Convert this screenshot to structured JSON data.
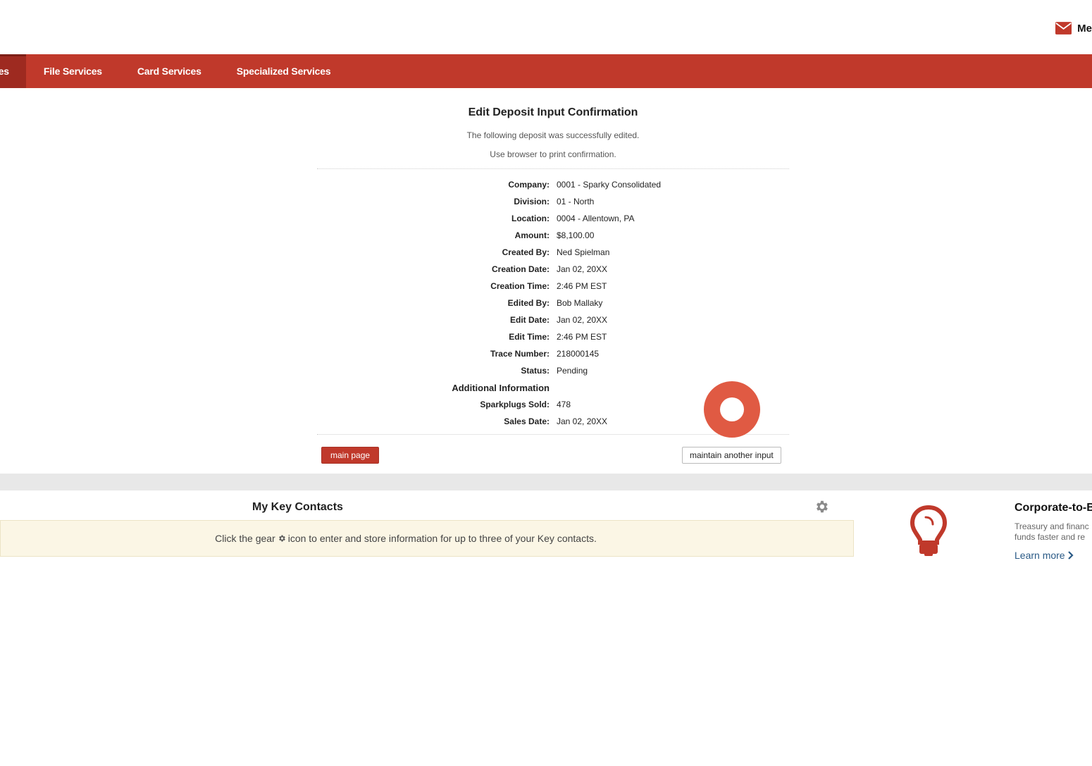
{
  "header": {
    "messages_label": "Me"
  },
  "nav": {
    "items": [
      {
        "label": "les"
      },
      {
        "label": "File Services"
      },
      {
        "label": "Card Services"
      },
      {
        "label": "Specialized Services"
      }
    ]
  },
  "confirmation": {
    "title": "Edit Deposit Input Confirmation",
    "message": "The following deposit was successfully edited.",
    "print_note": "Use browser to print confirmation.",
    "fields": [
      {
        "label": "Company:",
        "value": "0001 - Sparky Consolidated"
      },
      {
        "label": "Division:",
        "value": "01 - North"
      },
      {
        "label": "Location:",
        "value": "0004 - Allentown, PA"
      },
      {
        "label": "Amount:",
        "value": "$8,100.00"
      },
      {
        "label": "Created By:",
        "value": "Ned Spielman"
      },
      {
        "label": "Creation Date:",
        "value": "Jan 02, 20XX"
      },
      {
        "label": "Creation Time:",
        "value": "2:46 PM EST"
      },
      {
        "label": "Edited By:",
        "value": "Bob Mallaky"
      },
      {
        "label": "Edit Date:",
        "value": "Jan 02, 20XX"
      },
      {
        "label": "Edit Time:",
        "value": "2:46 PM EST"
      },
      {
        "label": "Trace Number:",
        "value": "218000145"
      },
      {
        "label": "Status:",
        "value": "Pending"
      }
    ],
    "additional_heading": "Additional Information",
    "additional_fields": [
      {
        "label": "Sparkplugs Sold:",
        "value": "478"
      },
      {
        "label": "Sales Date:",
        "value": "Jan 02, 20XX"
      }
    ],
    "main_page_button": "main page",
    "maintain_button": "maintain another input"
  },
  "contacts": {
    "title": "My Key Contacts",
    "note_before": "Click the gear",
    "note_after": "icon to enter and store information for up to three of your Key contacts."
  },
  "promo": {
    "title": "Corporate-to-B",
    "line1": "Treasury and financ",
    "line2": "funds faster and re",
    "learn_more": "Learn more"
  },
  "colors": {
    "brand_red": "#c0392b",
    "nav_active": "#9e2a20",
    "marker": "#e05a43",
    "note_bg": "#fbf6e5",
    "link": "#2a5a86"
  }
}
